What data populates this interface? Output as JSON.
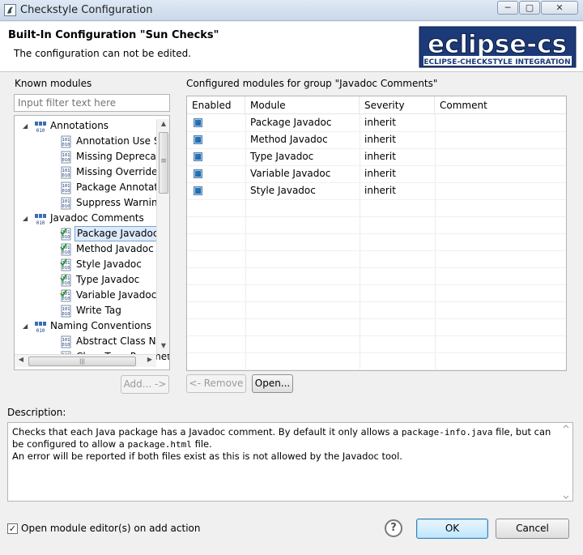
{
  "window": {
    "title": "Checkstyle Configuration",
    "min": "─",
    "max": "▢",
    "close": "✕"
  },
  "header": {
    "title": "Built-In Configuration \"Sun Checks\"",
    "subtitle": "The configuration can not be edited.",
    "logo_text": "eclipse-cs",
    "logo_sub": "ECLIPSE-CHECKSTYLE INTEGRATION"
  },
  "known_modules": {
    "label": "Known modules",
    "filter_placeholder": "Input filter text here",
    "tree": [
      {
        "label": "Annotations",
        "level": 0,
        "icon": "group-icon",
        "expanded": true
      },
      {
        "label": "Annotation Use Style",
        "level": 1,
        "icon": "module-icon"
      },
      {
        "label": "Missing Deprecated",
        "level": 1,
        "icon": "module-icon"
      },
      {
        "label": "Missing Override",
        "level": 1,
        "icon": "module-icon"
      },
      {
        "label": "Package Annotation",
        "level": 1,
        "icon": "module-icon"
      },
      {
        "label": "Suppress Warnings",
        "level": 1,
        "icon": "module-icon"
      },
      {
        "label": "Javadoc Comments",
        "level": 0,
        "icon": "group-icon",
        "expanded": true
      },
      {
        "label": "Package Javadoc",
        "level": 1,
        "icon": "module-checked-icon",
        "selected": true
      },
      {
        "label": "Method Javadoc",
        "level": 1,
        "icon": "module-checked-icon"
      },
      {
        "label": "Style Javadoc",
        "level": 1,
        "icon": "module-checked-icon"
      },
      {
        "label": "Type Javadoc",
        "level": 1,
        "icon": "module-checked-icon"
      },
      {
        "label": "Variable Javadoc",
        "level": 1,
        "icon": "module-checked-icon"
      },
      {
        "label": "Write Tag",
        "level": 1,
        "icon": "module-icon"
      },
      {
        "label": "Naming Conventions",
        "level": 0,
        "icon": "group-icon",
        "expanded": true
      },
      {
        "label": "Abstract Class Name",
        "level": 1,
        "icon": "module-icon"
      },
      {
        "label": "Class Type Parameter Name",
        "level": 1,
        "icon": "module-icon"
      }
    ],
    "add_button": "Add... ->",
    "hscroll_grip": "|||",
    "vscroll_grip": "≡"
  },
  "configured_modules": {
    "label": "Configured modules for group \"Javadoc Comments\"",
    "columns": [
      "Enabled",
      "Module",
      "Severity",
      "Comment"
    ],
    "rows": [
      {
        "enabled": true,
        "module": "Package Javadoc",
        "severity": "inherit",
        "comment": ""
      },
      {
        "enabled": true,
        "module": "Method Javadoc",
        "severity": "inherit",
        "comment": ""
      },
      {
        "enabled": true,
        "module": "Type Javadoc",
        "severity": "inherit",
        "comment": ""
      },
      {
        "enabled": true,
        "module": "Variable Javadoc",
        "severity": "inherit",
        "comment": ""
      },
      {
        "enabled": true,
        "module": "Style Javadoc",
        "severity": "inherit",
        "comment": ""
      }
    ],
    "remove_button": "<- Remove",
    "open_button": "Open..."
  },
  "description": {
    "label": "Description:",
    "line1_a": "Checks that each Java package has a Javadoc comment. By default it only allows a ",
    "line1_code": "package-info.java",
    "line1_b": " file, but can",
    "line2_a": "be configured to allow a ",
    "line2_code": "package.html",
    "line2_b": " file.",
    "line3": "An error will be reported if both files exist as this is not allowed by the Javadoc tool."
  },
  "footer": {
    "open_editor_label": "Open module editor(s) on add action",
    "open_editor_checked": true,
    "check_mark": "✓",
    "help": "?",
    "ok": "OK",
    "cancel": "Cancel"
  },
  "colors": {
    "selection_bg": "#dcebfc",
    "default_button": "#bee6fd",
    "checkbox_blue": "#1a5f9d"
  }
}
